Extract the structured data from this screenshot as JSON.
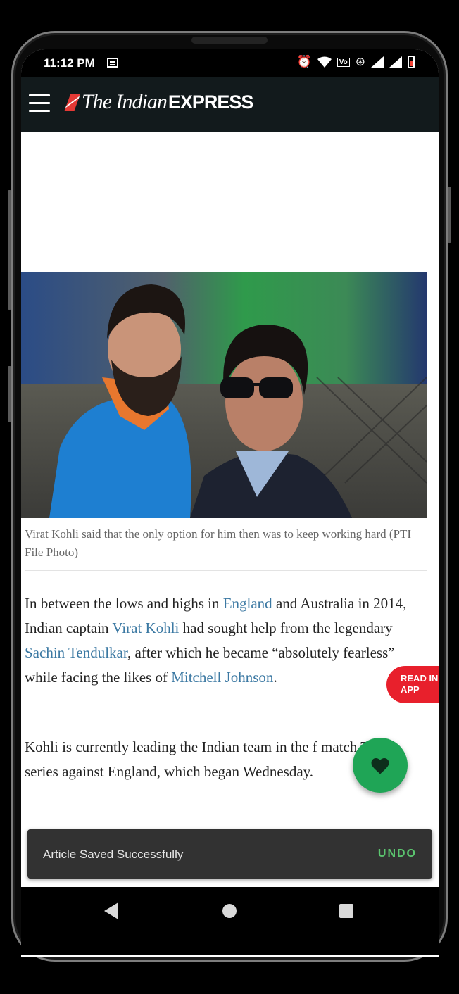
{
  "status": {
    "time": "11:12 PM",
    "icons": [
      "news-icon",
      "alarm-icon",
      "wifi-icon",
      "volte-icon",
      "hotspot-icon",
      "signal-icon",
      "signal-icon",
      "battery-icon"
    ]
  },
  "appbar": {
    "logo_part1": "The Indian",
    "logo_part2": "EXPRESS"
  },
  "article": {
    "caption": "Virat Kohli said that the only option for him then was to keep working hard (PTI File Photo)",
    "p1": {
      "t1": "In between the lows and highs in ",
      "l1": "England",
      "t2": " and Australia in 2014, Indian captain ",
      "l2": "Virat Kohli",
      "t3": " had sought help from the legendary ",
      "l3": "Sachin Tendulkar",
      "t4": ", after which he became “absolutely fearless” while facing the likes of ",
      "l4": "Mitchell Johnson",
      "t5": "."
    },
    "p2_visible": "Kohli is currently leading the Indian team in the f match Test series against England, which began Wednesday."
  },
  "read_in_app": "READ IN APP",
  "snackbar": {
    "message": "Article Saved Successfully",
    "action": "UNDO"
  },
  "colors": {
    "link": "#3c79a3",
    "fab": "#1fa556",
    "read_in_app": "#e8202c",
    "snackbar_action": "#5bc56f",
    "appbar": "#121a1c"
  }
}
